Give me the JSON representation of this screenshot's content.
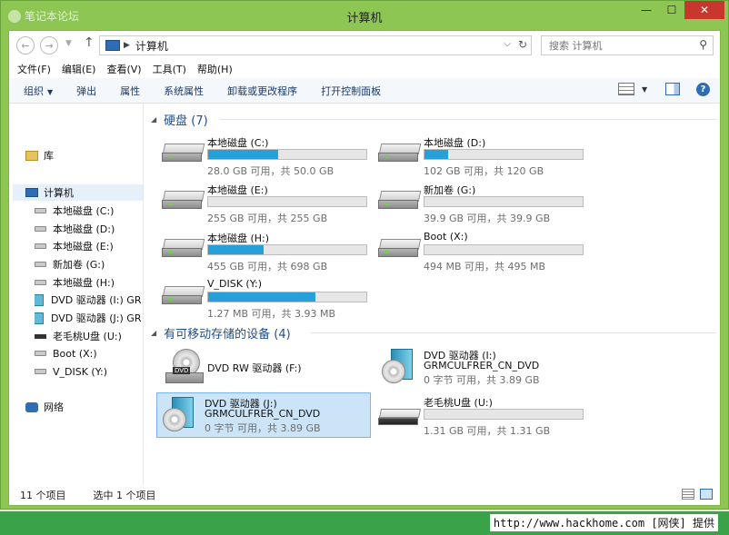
{
  "window": {
    "title": "计算机",
    "watermark": "笔记本论坛",
    "controls": {
      "minimize": "—",
      "maximize": "☐",
      "close": "✕"
    }
  },
  "address": {
    "path": "计算机",
    "search_placeholder": "搜索 计算机"
  },
  "menu": [
    "文件(F)",
    "编辑(E)",
    "查看(V)",
    "工具(T)",
    "帮助(H)"
  ],
  "toolbar": {
    "organize": "组织",
    "eject": "弹出",
    "properties": "属性",
    "system_properties": "系统属性",
    "uninstall": "卸载或更改程序",
    "control_panel": "打开控制面板"
  },
  "sidebar": {
    "library": "库",
    "computer": "计算机",
    "network": "网络",
    "drives": [
      {
        "label": "本地磁盘 (C:)",
        "icon": "drive-icon"
      },
      {
        "label": "本地磁盘 (D:)",
        "icon": "drive-icon"
      },
      {
        "label": "本地磁盘 (E:)",
        "icon": "drive-icon"
      },
      {
        "label": "新加卷 (G:)",
        "icon": "drive-icon"
      },
      {
        "label": "本地磁盘 (H:)",
        "icon": "drive-icon"
      },
      {
        "label": "DVD 驱动器 (I:) GR",
        "icon": "dvd-icon"
      },
      {
        "label": "DVD 驱动器 (J:) GR",
        "icon": "dvd-icon"
      },
      {
        "label": "老毛桃U盘 (U:)",
        "icon": "usb-icon"
      },
      {
        "label": "Boot (X:)",
        "icon": "drive-icon"
      },
      {
        "label": "V_DISK (Y:)",
        "icon": "drive-icon"
      }
    ]
  },
  "sections": {
    "hard_disks": "硬盘 (7)",
    "removable": "有可移动存储的设备 (4)"
  },
  "hard_disks": [
    {
      "name": "本地磁盘 (C:)",
      "info": "28.0 GB 可用，共 50.0 GB",
      "used_fraction": 0.44
    },
    {
      "name": "本地磁盘 (D:)",
      "info": "102 GB 可用，共 120 GB",
      "used_fraction": 0.15
    },
    {
      "name": "本地磁盘 (E:)",
      "info": "255 GB 可用，共 255 GB",
      "used_fraction": 0.0
    },
    {
      "name": "新加卷 (G:)",
      "info": "39.9 GB 可用，共 39.9 GB",
      "used_fraction": 0.0
    },
    {
      "name": "本地磁盘 (H:)",
      "info": "455 GB 可用，共 698 GB",
      "used_fraction": 0.35
    },
    {
      "name": "Boot (X:)",
      "info": "494 MB 可用，共 495 MB",
      "used_fraction": 0.0
    },
    {
      "name": "V_DISK (Y:)",
      "info": "1.27 MB 可用，共 3.93 MB",
      "used_fraction": 0.68
    }
  ],
  "removable": [
    {
      "name": "DVD RW 驱动器 (F:)",
      "sub": "",
      "info": ""
    },
    {
      "name": "DVD 驱动器 (I:)",
      "sub": "GRMCULFRER_CN_DVD",
      "info": "0 字节 可用，共 3.89 GB"
    },
    {
      "name": "DVD 驱动器 (J:)",
      "sub": "GRMCULFRER_CN_DVD",
      "info": "0 字节 可用，共 3.89 GB"
    },
    {
      "name": "老毛桃U盘 (U:)",
      "info": "1.31 GB 可用，共 1.31 GB",
      "used_fraction": 0.0
    }
  ],
  "dvd_badge": "DVD",
  "status": {
    "count": "11 个项目",
    "selected": "选中 1 个项目"
  },
  "footer": "http://www.hackhome.com [网侠] 提供"
}
